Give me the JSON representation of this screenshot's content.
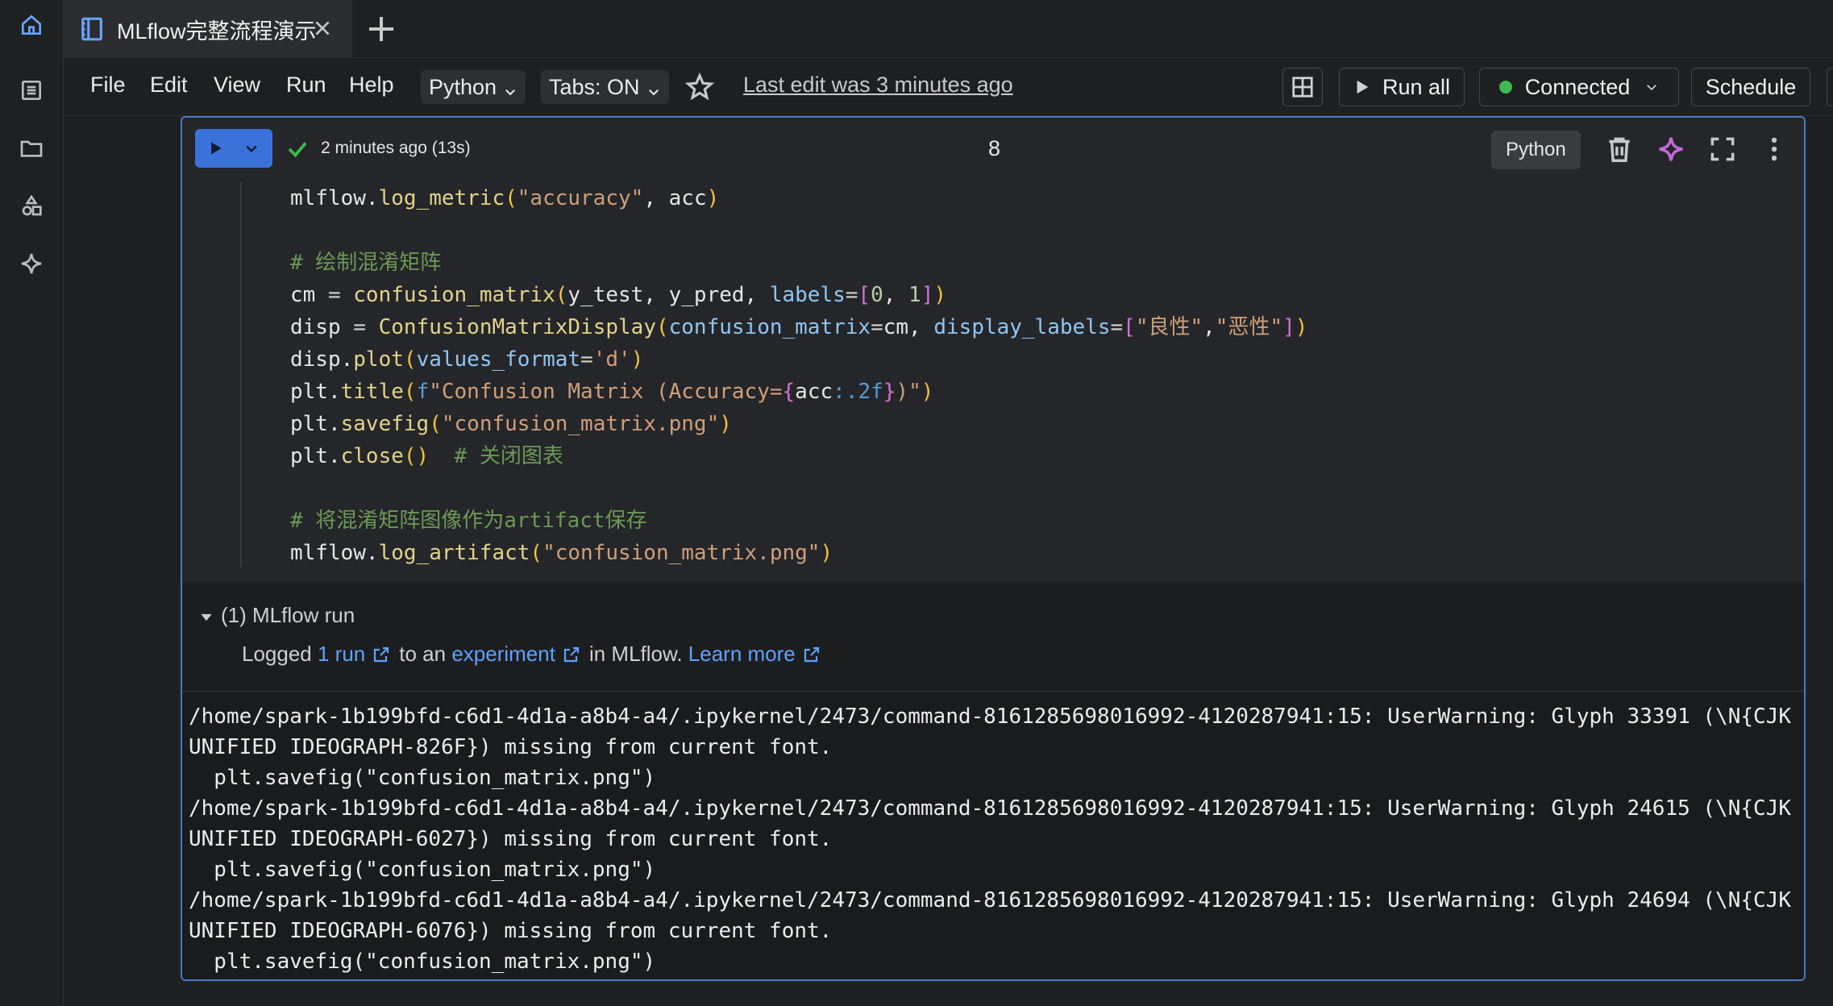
{
  "rail": {
    "items": [
      {
        "name": "home-icon"
      },
      {
        "name": "workspace-list-icon"
      },
      {
        "name": "folder-icon"
      },
      {
        "name": "shapes-icon"
      },
      {
        "name": "sparkle-icon"
      }
    ]
  },
  "tab": {
    "title": "MLflow完整流程演示"
  },
  "menu": {
    "file": "File",
    "edit": "Edit",
    "view": "View",
    "run": "Run",
    "help": "Help",
    "language": "Python",
    "tabs": "Tabs: ON",
    "last_edit": "Last edit was 3 minutes ago",
    "run_all": "Run all",
    "connected": "Connected",
    "schedule": "Schedule"
  },
  "cell": {
    "status": "2 minutes ago (13s)",
    "exec_count": "8",
    "language": "Python"
  },
  "code_lines": [
    "mlflow.log_metric(\"accuracy\", acc)",
    "",
    "# 绘制混淆矩阵",
    "cm = confusion_matrix(y_test, y_pred, labels=[0, 1])",
    "disp = ConfusionMatrixDisplay(confusion_matrix=cm, display_labels=[\"良性\",\"恶性\"])",
    "disp.plot(values_format='d')",
    "plt.title(f\"Confusion Matrix (Accuracy={acc:.2f})\")",
    "plt.savefig(\"confusion_matrix.png\")",
    "plt.close()  # 关闭图表",
    "",
    "# 将混淆矩阵图像作为artifact保存",
    "mlflow.log_artifact(\"confusion_matrix.png\")"
  ],
  "mlflow": {
    "title": "(1) MLflow run",
    "logged": "Logged",
    "run_link": "1 run",
    "to_an": "to an",
    "experiment_link": "experiment",
    "in_mlflow": "in MLflow.",
    "learn_more": "Learn more"
  },
  "output": "/home/spark-1b199bfd-c6d1-4d1a-a8b4-a4/.ipykernel/2473/command-8161285698016992-4120287941:15: UserWarning: Glyph 33391 (\\N{CJK\nUNIFIED IDEOGRAPH-826F}) missing from current font.\n  plt.savefig(\"confusion_matrix.png\")\n/home/spark-1b199bfd-c6d1-4d1a-a8b4-a4/.ipykernel/2473/command-8161285698016992-4120287941:15: UserWarning: Glyph 24615 (\\N{CJK\nUNIFIED IDEOGRAPH-6027}) missing from current font.\n  plt.savefig(\"confusion_matrix.png\")\n/home/spark-1b199bfd-c6d1-4d1a-a8b4-a4/.ipykernel/2473/command-8161285698016992-4120287941:15: UserWarning: Glyph 24694 (\\N{CJK\nUNIFIED IDEOGRAPH-6076}) missing from current font.\n  plt.savefig(\"confusion_matrix.png\")",
  "colors": {
    "accent": "#3b72d9",
    "link": "#5ea2ff",
    "success": "#3fb950",
    "background": "#1e1f21"
  }
}
